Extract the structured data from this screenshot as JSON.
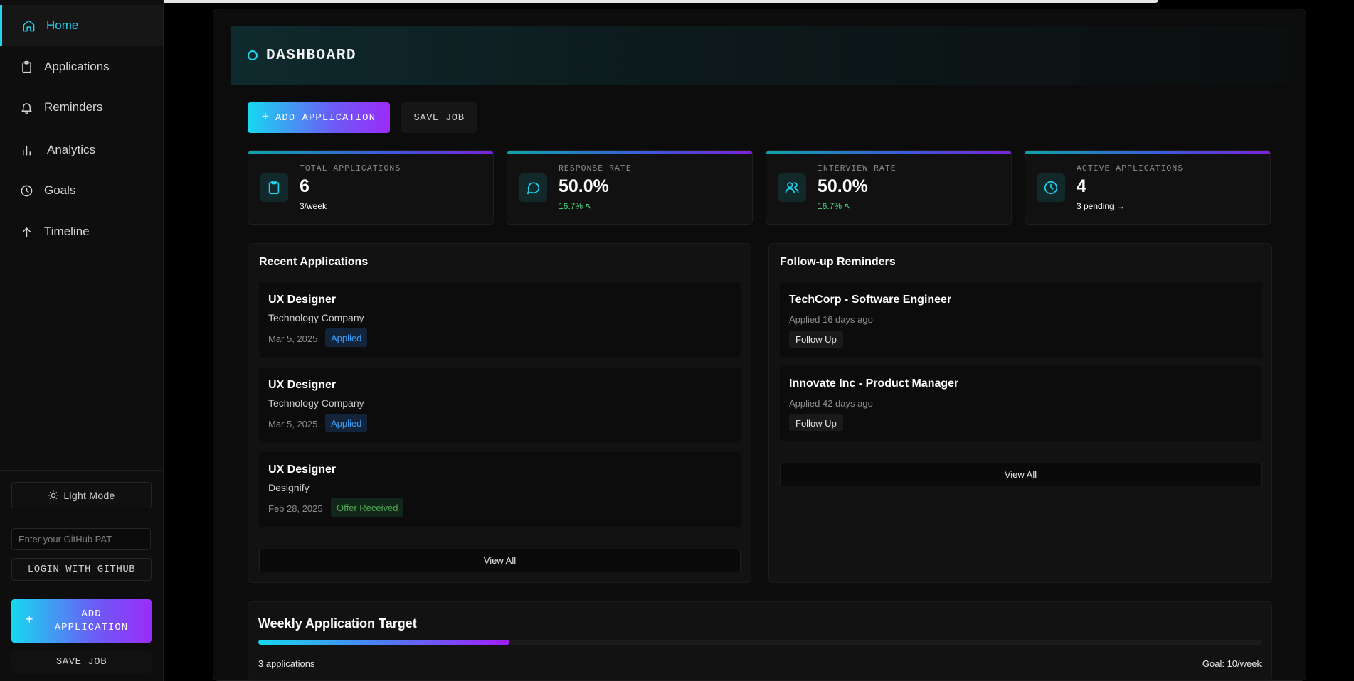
{
  "sidebar": {
    "items": [
      {
        "label": "Home",
        "icon": "home-icon",
        "active": true
      },
      {
        "label": "Applications",
        "icon": "clipboard-icon"
      },
      {
        "label": "Reminders",
        "icon": "bell-icon"
      },
      {
        "label": "Analytics",
        "icon": "bar-chart-icon"
      },
      {
        "label": "Goals",
        "icon": "clock-icon"
      },
      {
        "label": "Timeline",
        "icon": "arrow-up-icon"
      }
    ],
    "theme_toggle": "Light Mode",
    "github_placeholder": "Enter your GitHub PAT",
    "github_login": "LOGIN WITH GITHUB",
    "add_application": "ADD APPLICATION",
    "save_job": "SAVE JOB"
  },
  "header": {
    "title": "DASHBOARD"
  },
  "actions": {
    "add_application": "ADD APPLICATION",
    "save_job": "SAVE JOB"
  },
  "stats": [
    {
      "label": "TOTAL APPLICATIONS",
      "value": "6",
      "sub": "3/week",
      "icon": "clipboard-icon"
    },
    {
      "label": "RESPONSE RATE",
      "value": "50.0%",
      "sub": "16.7% ↖",
      "icon": "message-circle-icon"
    },
    {
      "label": "INTERVIEW RATE",
      "value": "50.0%",
      "sub": "16.7% ↖",
      "icon": "users-icon"
    },
    {
      "label": "ACTIVE APPLICATIONS",
      "value": "4",
      "sub": "3 pending →",
      "icon": "clock-icon"
    }
  ],
  "recent": {
    "title": "Recent Applications",
    "items": [
      {
        "title": "UX Designer",
        "company": "Technology Company",
        "date": "Mar 5, 2025",
        "status": "Applied"
      },
      {
        "title": "UX Designer",
        "company": "Technology Company",
        "date": "Mar 5, 2025",
        "status": "Applied"
      },
      {
        "title": "UX Designer",
        "company": "Designify",
        "date": "Feb 28, 2025",
        "status": "Offer Received"
      }
    ],
    "view_all": "View All"
  },
  "reminders": {
    "title": "Follow-up Reminders",
    "items": [
      {
        "title": "TechCorp - Software Engineer",
        "sub": "Applied 16 days ago",
        "action": "Follow Up"
      },
      {
        "title": "Innovate Inc - Product Manager",
        "sub": "Applied 42 days ago",
        "action": "Follow Up"
      }
    ],
    "view_all": "View All"
  },
  "target": {
    "title": "Weekly Application Target",
    "progress": 0.25,
    "left_label": "3 applications",
    "right_label": "Goal: 10/week"
  },
  "colors": {
    "accent": "#22d3ee",
    "purple": "#9b2cf7",
    "applied": "#3b9cf6",
    "offer": "#4caf50"
  }
}
